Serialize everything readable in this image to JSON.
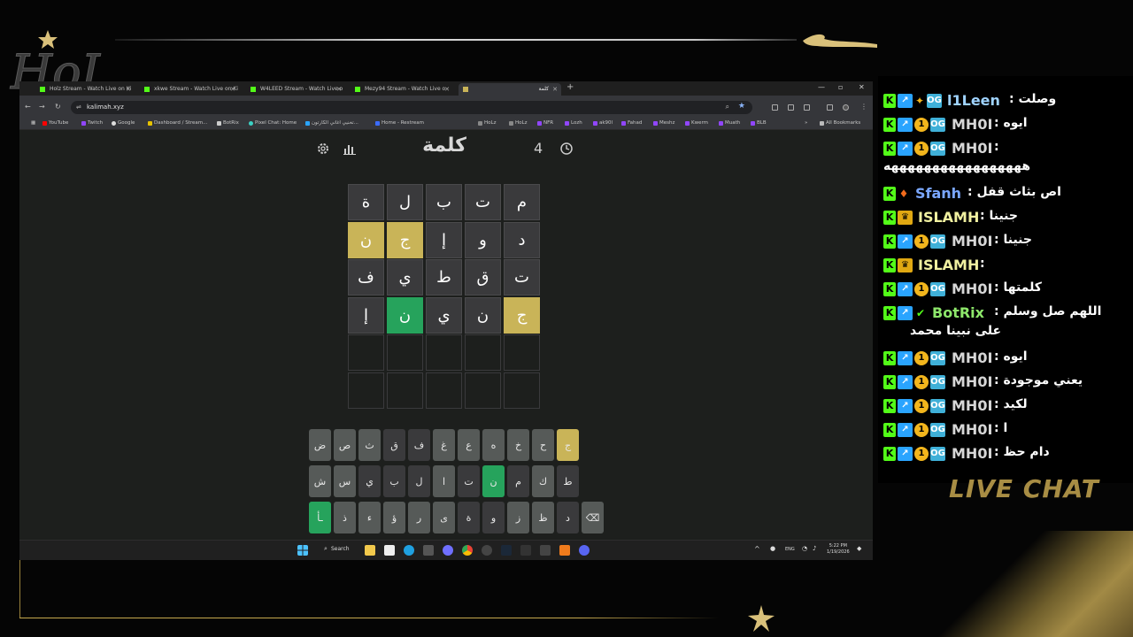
{
  "overlay": {
    "logo_text": "Holz",
    "live_chat_label": "LIVE CHAT",
    "accent": "#c9a94e"
  },
  "browser": {
    "tabs": [
      {
        "title": "Holz Stream - Watch Live on Ki"
      },
      {
        "title": "xkwe Stream - Watch Live on Ki"
      },
      {
        "title": "W4LEED Stream - Watch Live o"
      },
      {
        "title": "Mezy94 Stream - Watch Live o"
      },
      {
        "title": "كلمة",
        "active": true
      }
    ],
    "url": "kalimah.xyz",
    "bookmarks": [
      "YouTube",
      "Twitch",
      "Google",
      "Dashboard / Stream...",
      "BotRix",
      "Pixel Chat: Home",
      "تخنيي اغاني الكارتون...",
      "Home - Restream",
      "HoLz",
      "HoLz",
      "NFR",
      "Lozh",
      "ak90l",
      "Fahad",
      "Meshz",
      "Kwerm",
      "Muath",
      "BLB"
    ],
    "all_bookmarks_label": "All Bookmarks"
  },
  "game": {
    "title": "كلمة",
    "streak": "4",
    "board": [
      [
        {
          "l": "م",
          "s": "filled"
        },
        {
          "l": "ت",
          "s": "filled"
        },
        {
          "l": "ب",
          "s": "filled"
        },
        {
          "l": "ل",
          "s": "filled"
        },
        {
          "l": "ة",
          "s": "filled"
        }
      ],
      [
        {
          "l": "د",
          "s": "filled"
        },
        {
          "l": "و",
          "s": "filled"
        },
        {
          "l": "إ",
          "s": "filled"
        },
        {
          "l": "ج",
          "s": "present"
        },
        {
          "l": "ن",
          "s": "present"
        }
      ],
      [
        {
          "l": "ت",
          "s": "filled"
        },
        {
          "l": "ق",
          "s": "filled"
        },
        {
          "l": "ط",
          "s": "filled"
        },
        {
          "l": "ي",
          "s": "filled"
        },
        {
          "l": "ف",
          "s": "filled"
        }
      ],
      [
        {
          "l": "ج",
          "s": "present"
        },
        {
          "l": "ن",
          "s": "filled"
        },
        {
          "l": "ي",
          "s": "filled"
        },
        {
          "l": "ن",
          "s": "correct"
        },
        {
          "l": "إ",
          "s": "filled"
        }
      ],
      [
        {
          "l": "",
          "s": "empty"
        },
        {
          "l": "",
          "s": "empty"
        },
        {
          "l": "",
          "s": "empty"
        },
        {
          "l": "",
          "s": "empty"
        },
        {
          "l": "",
          "s": "empty"
        }
      ],
      [
        {
          "l": "",
          "s": "empty"
        },
        {
          "l": "",
          "s": "empty"
        },
        {
          "l": "",
          "s": "empty"
        },
        {
          "l": "",
          "s": "empty"
        },
        {
          "l": "",
          "s": "empty"
        }
      ]
    ],
    "keyboard": [
      [
        {
          "k": "ج",
          "s": "present"
        },
        {
          "k": "ح",
          "s": "key"
        },
        {
          "k": "خ",
          "s": "key"
        },
        {
          "k": "ه",
          "s": "key"
        },
        {
          "k": "ع",
          "s": "key"
        },
        {
          "k": "غ",
          "s": "key"
        },
        {
          "k": "ف",
          "s": "dark"
        },
        {
          "k": "ق",
          "s": "dark"
        },
        {
          "k": "ث",
          "s": "key"
        },
        {
          "k": "ص",
          "s": "key"
        },
        {
          "k": "ض",
          "s": "key"
        }
      ],
      [
        {
          "k": "ط",
          "s": "dark"
        },
        {
          "k": "ك",
          "s": "key"
        },
        {
          "k": "م",
          "s": "dark"
        },
        {
          "k": "ن",
          "s": "correct"
        },
        {
          "k": "ت",
          "s": "dark"
        },
        {
          "k": "ا",
          "s": "key"
        },
        {
          "k": "ل",
          "s": "dark"
        },
        {
          "k": "ب",
          "s": "dark"
        },
        {
          "k": "ي",
          "s": "dark"
        },
        {
          "k": "س",
          "s": "key"
        },
        {
          "k": "ش",
          "s": "key"
        }
      ],
      [
        {
          "k": "⌫",
          "s": "key"
        },
        {
          "k": "د",
          "s": "dark"
        },
        {
          "k": "ظ",
          "s": "key"
        },
        {
          "k": "ز",
          "s": "key"
        },
        {
          "k": "و",
          "s": "dark"
        },
        {
          "k": "ة",
          "s": "dark"
        },
        {
          "k": "ى",
          "s": "key"
        },
        {
          "k": "ر",
          "s": "key"
        },
        {
          "k": "ؤ",
          "s": "key"
        },
        {
          "k": "ء",
          "s": "key"
        },
        {
          "k": "ذ",
          "s": "key"
        },
        {
          "k": "ـأ",
          "s": "correct"
        }
      ]
    ]
  },
  "taskbar": {
    "search_label": "Search",
    "lang": "ENG",
    "time": "5:22 PM",
    "date": "1/19/2026"
  },
  "chat": {
    "messages": [
      {
        "user": "l1Leen",
        "color": "#9fd3ff",
        "text": "وصلت :",
        "badges": [
          "kick",
          "sub",
          "star",
          "og"
        ]
      },
      {
        "user": "MH0I",
        "color": "#d7d7d7",
        "text": "ايوه :",
        "badges": [
          "kick",
          "sub",
          "gift",
          "og"
        ]
      },
      {
        "user": "MH0I",
        "color": "#d7d7d7",
        "text": ":",
        "wrap": "هههههههههههههههههه",
        "badges": [
          "kick",
          "sub",
          "gift",
          "og"
        ]
      },
      {
        "user": "Sfanh",
        "color": "#7aa7ff",
        "text": "اص بثاث قفل :",
        "badges": [
          "kick",
          "flame"
        ]
      },
      {
        "user": "ISLAMH",
        "color": "#f0f0a0",
        "text": "جنينا :",
        "badges": [
          "kick",
          "crown"
        ]
      },
      {
        "user": "MH0I",
        "color": "#d7d7d7",
        "text": "جنينا :",
        "badges": [
          "kick",
          "sub",
          "gift",
          "og"
        ]
      },
      {
        "user": "ISLAMH",
        "color": "#f0f0a0",
        "text": ":",
        "badges": [
          "kick",
          "crown"
        ]
      },
      {
        "user": "MH0I",
        "color": "#d7d7d7",
        "text": "كلمتها :",
        "badges": [
          "kick",
          "sub",
          "gift",
          "og"
        ]
      },
      {
        "user": "BotRix",
        "color": "#8ee86b",
        "text": "اللهم صل وسلم :",
        "wrap": "على نبينا محمد",
        "badges": [
          "kick",
          "sub",
          "ver"
        ]
      },
      {
        "user": "MH0I",
        "color": "#d7d7d7",
        "text": "ايوه :",
        "badges": [
          "kick",
          "sub",
          "gift",
          "og"
        ]
      },
      {
        "user": "MH0I",
        "color": "#d7d7d7",
        "text": "يعني موجودة :",
        "badges": [
          "kick",
          "sub",
          "gift",
          "og"
        ]
      },
      {
        "user": "MH0I",
        "color": "#d7d7d7",
        "text": "لكيد :",
        "badges": [
          "kick",
          "sub",
          "gift",
          "og"
        ]
      },
      {
        "user": "MH0I",
        "color": "#d7d7d7",
        "text": "ا :",
        "badges": [
          "kick",
          "sub",
          "gift",
          "og"
        ]
      },
      {
        "user": "MH0I",
        "color": "#d7d7d7",
        "text": "دام حظ :",
        "badges": [
          "kick",
          "sub",
          "gift",
          "og"
        ]
      }
    ]
  }
}
